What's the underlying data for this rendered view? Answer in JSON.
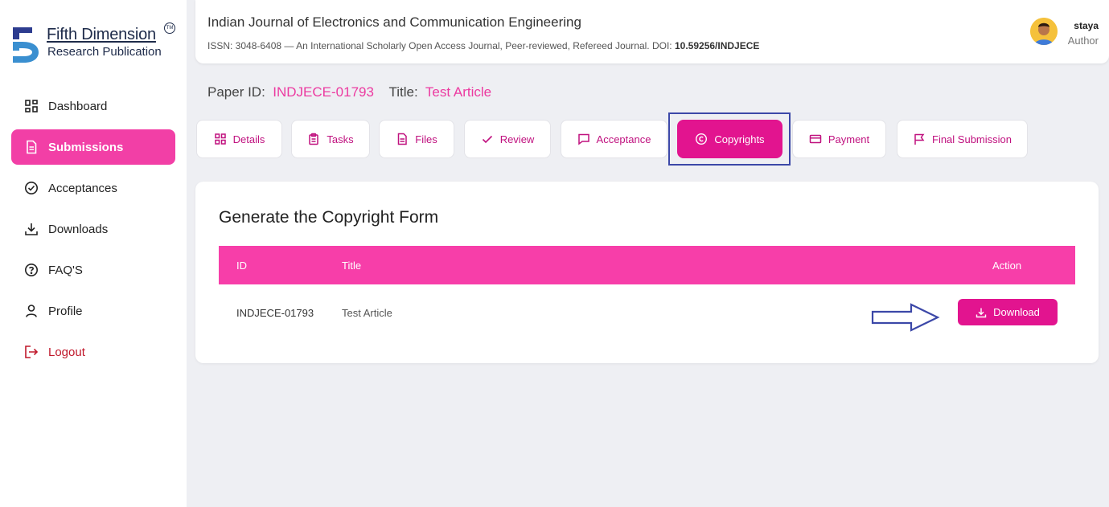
{
  "sidebar": {
    "logo": {
      "line1": "Fifth Dimension",
      "line2": "Research Publication",
      "tm": "TM"
    },
    "items": [
      {
        "label": "Dashboard",
        "icon": "grid-icon"
      },
      {
        "label": "Submissions",
        "icon": "document-icon",
        "active": true
      },
      {
        "label": "Acceptances",
        "icon": "check-circle-icon"
      },
      {
        "label": "Downloads",
        "icon": "download-icon"
      },
      {
        "label": "FAQ'S",
        "icon": "help-circle-icon"
      },
      {
        "label": "Profile",
        "icon": "user-icon"
      },
      {
        "label": "Logout",
        "icon": "logout-icon"
      }
    ]
  },
  "header": {
    "journal_title": "Indian Journal of Electronics and Communication Engineering",
    "journal_sub": "ISSN: 3048-6408 — An International Scholarly Open Access Journal, Peer-reviewed, Refereed Journal. DOI:",
    "doi": "10.59256/INDJECE",
    "user_name": "staya",
    "user_role": "Author"
  },
  "paper": {
    "id_label": "Paper ID:",
    "id_value": "INDJECE-01793",
    "title_label": "Title:",
    "title_value": "Test Article"
  },
  "tabs": [
    {
      "label": "Details",
      "icon": "grid-icon"
    },
    {
      "label": "Tasks",
      "icon": "clipboard-icon"
    },
    {
      "label": "Files",
      "icon": "file-icon"
    },
    {
      "label": "Review",
      "icon": "check-icon"
    },
    {
      "label": "Acceptance",
      "icon": "message-icon"
    },
    {
      "label": "Copyrights",
      "icon": "copyright-icon",
      "active": true
    },
    {
      "label": "Payment",
      "icon": "credit-card-icon"
    },
    {
      "label": "Final Submission",
      "icon": "flag-icon"
    }
  ],
  "copyright_card": {
    "title": "Generate the Copyright Form",
    "columns": {
      "id": "ID",
      "title": "Title",
      "action": "Action"
    },
    "row": {
      "id": "INDJECE-01793",
      "title": "Test Article",
      "action_label": "Download"
    }
  },
  "colors": {
    "accent": "#e2148f",
    "table_header": "#f73ea9",
    "highlight_box": "#3c48a8",
    "logout": "#c0182b"
  }
}
